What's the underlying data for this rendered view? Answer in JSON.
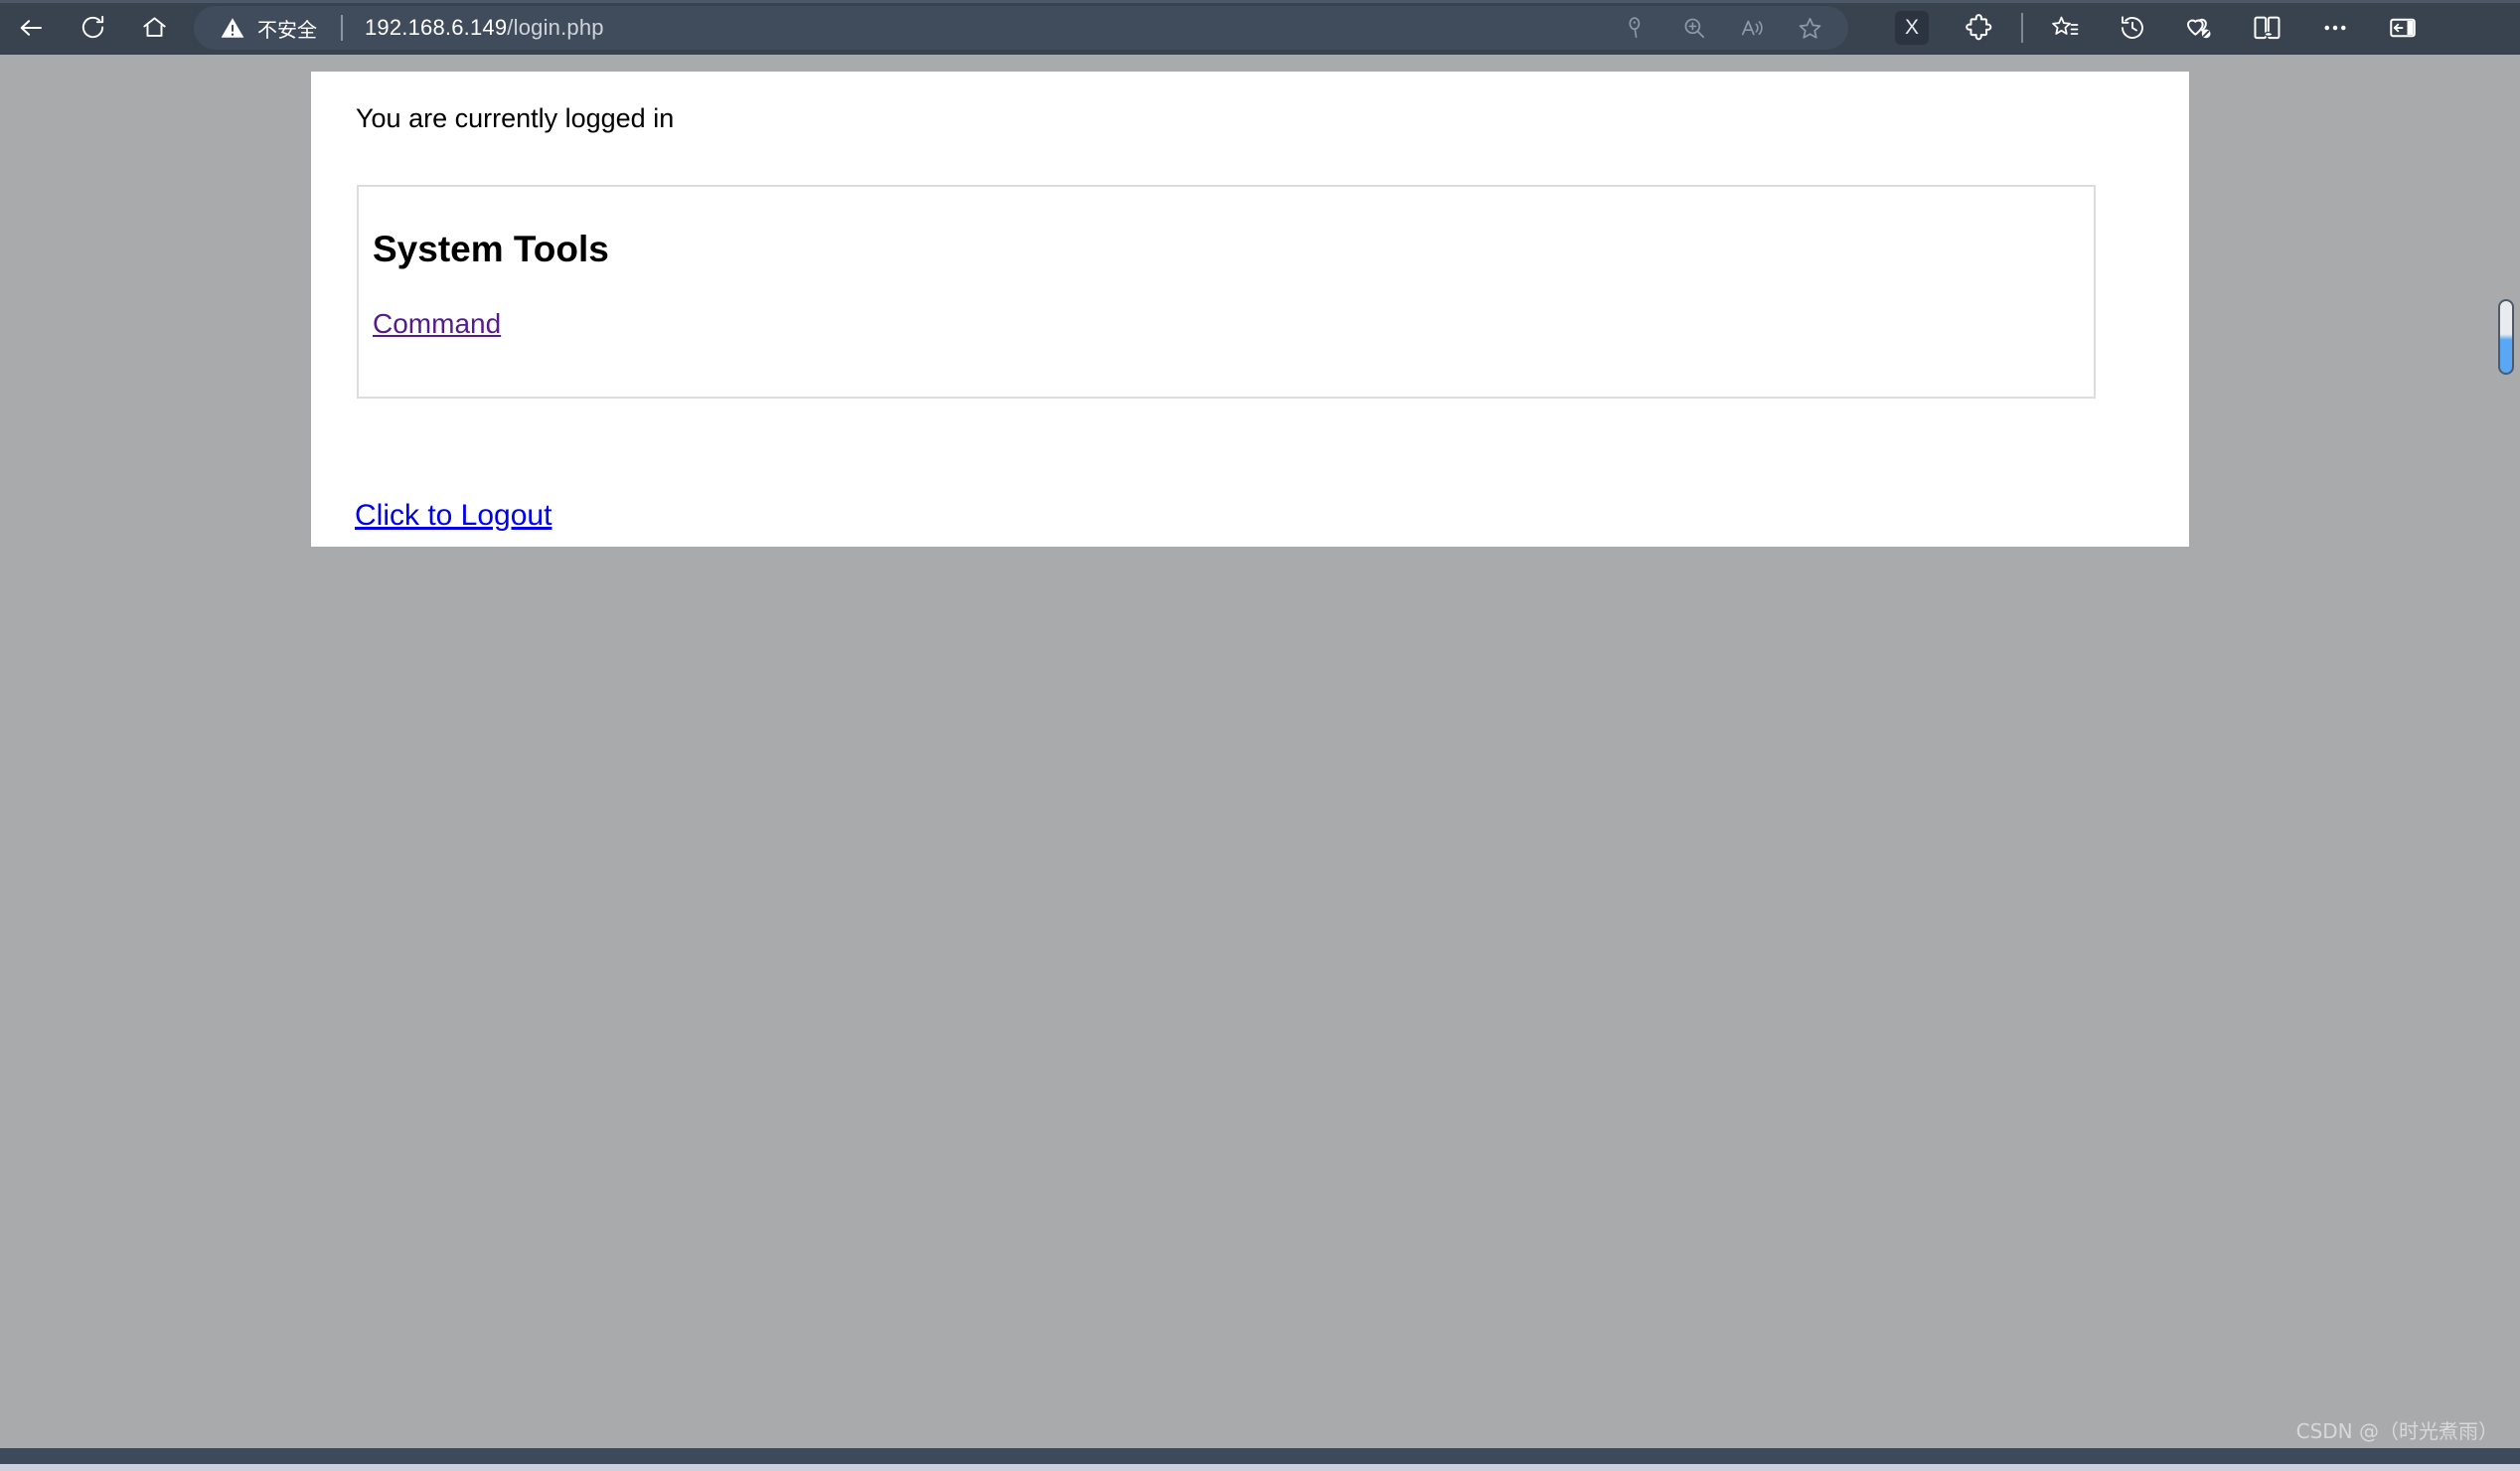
{
  "browser": {
    "nav": {
      "back_label": "Back",
      "refresh_label": "Refresh",
      "home_label": "Home"
    },
    "address": {
      "security_label": "不安全",
      "url_host": "192.168.6.149",
      "url_path": "/login.php",
      "full_url": "192.168.6.149/login.php",
      "actions": [
        {
          "name": "password-key-icon",
          "label": "Saved passwords"
        },
        {
          "name": "zoom-in-icon",
          "label": "Zoom"
        },
        {
          "name": "read-aloud-icon",
          "label": "Read aloud"
        },
        {
          "name": "favorite-star-icon",
          "label": "Add this page to favorites"
        }
      ]
    },
    "toolbar_right": [
      {
        "name": "x-extension-badge",
        "label": "X"
      },
      {
        "name": "puzzle-extensions-icon",
        "label": "Extensions"
      },
      {
        "name": "favorites-list-icon",
        "label": "Favorites"
      },
      {
        "name": "history-clock-icon",
        "label": "History"
      },
      {
        "name": "browser-essentials-icon",
        "label": "Browser essentials"
      },
      {
        "name": "split-screen-icon",
        "label": "Split screen"
      },
      {
        "name": "settings-more-icon",
        "label": "Settings and more"
      },
      {
        "name": "sidebar-panel-icon",
        "label": "Sidebar"
      }
    ]
  },
  "page": {
    "status_text": "You are currently logged in",
    "panel": {
      "title": "System Tools",
      "links": [
        {
          "label": "Command",
          "color": "#551a8b"
        }
      ]
    },
    "logout_link": {
      "label": "Click to Logout",
      "color": "#0000ee"
    }
  },
  "watermark": {
    "text": "CSDN @（时光煮雨）"
  },
  "colors": {
    "chrome_bg": "#39434f",
    "address_bg": "#404b5b",
    "page_bg": "#a9aaab",
    "card_bg": "#ffffff",
    "box_border": "#dcdcdc",
    "visited_link": "#551a8b",
    "link": "#0000ee",
    "bottom_bar": "#3d4a5c"
  }
}
